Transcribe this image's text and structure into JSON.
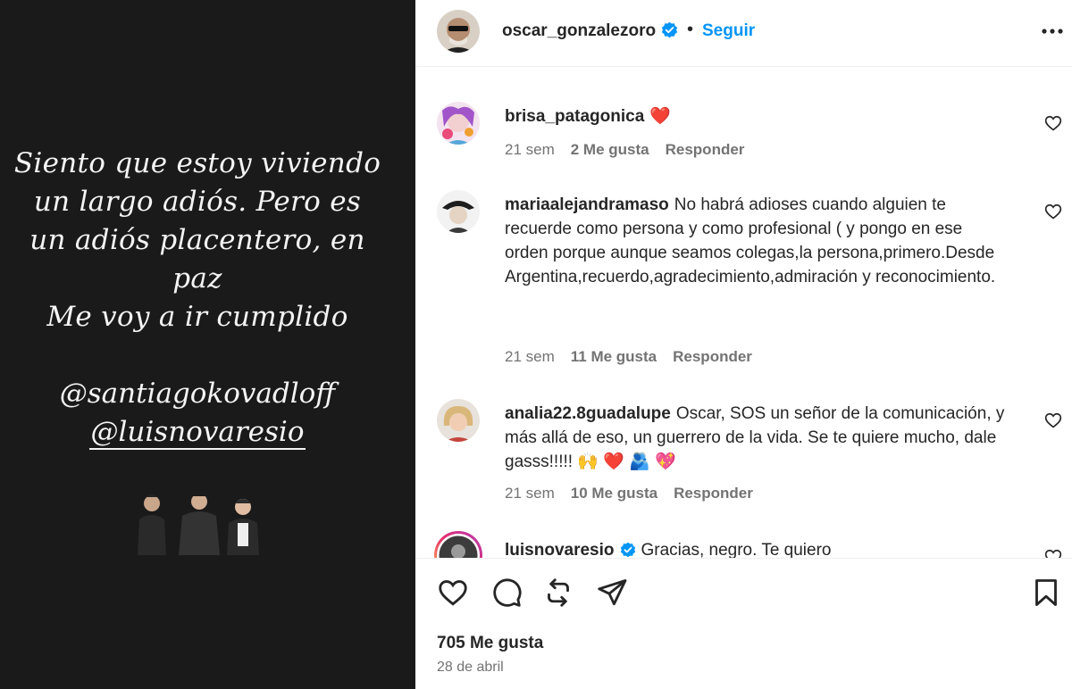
{
  "story": {
    "lines": [
      "Siento que estoy viviendo",
      "un largo adiós. Pero es",
      "un adiós placentero, en",
      "paz",
      "Me voy a ir cumplido"
    ],
    "mention_1": "@santiagokovadloff",
    "mention_2": "@luisnovaresio"
  },
  "header": {
    "username": "oscar_gonzalezoro",
    "separator": "•",
    "follow_label": "Seguir"
  },
  "comments": [
    {
      "user": "brisa_patagonica",
      "text": "❤️",
      "time": "21 sem",
      "likes": "2 Me gusta",
      "reply": "Responder"
    },
    {
      "user": "mariaalejandramaso",
      "text": "No habrá adioses cuando alguien te recuerde como persona y como profesional ( y pongo en ese orden porque aunque seamos colegas,la persona,primero.Desde Argentina,recuerdo,agradecimiento,admiración y reconocimiento.",
      "time": "21 sem",
      "likes": "11 Me gusta",
      "reply": "Responder"
    },
    {
      "user": "analia22.8guadalupe",
      "text": "Oscar, SOS un señor de la comunicación, y más allá de eso, un guerrero de la vida. Se te quiere mucho, dale gasss!!!!! 🙌 ❤️ 🫂 💖",
      "time": "21 sem",
      "likes": "10 Me gusta",
      "reply": "Responder"
    },
    {
      "user": "luisnovaresio",
      "text": "Gracias, negro. Te quiero"
    }
  ],
  "footer": {
    "likes": "705 Me gusta",
    "date": "28 de abril"
  },
  "colors": {
    "accent": "#0095f6",
    "verified": "#0095f6",
    "media_bg": "#1a1a1a",
    "muted": "#737373"
  }
}
